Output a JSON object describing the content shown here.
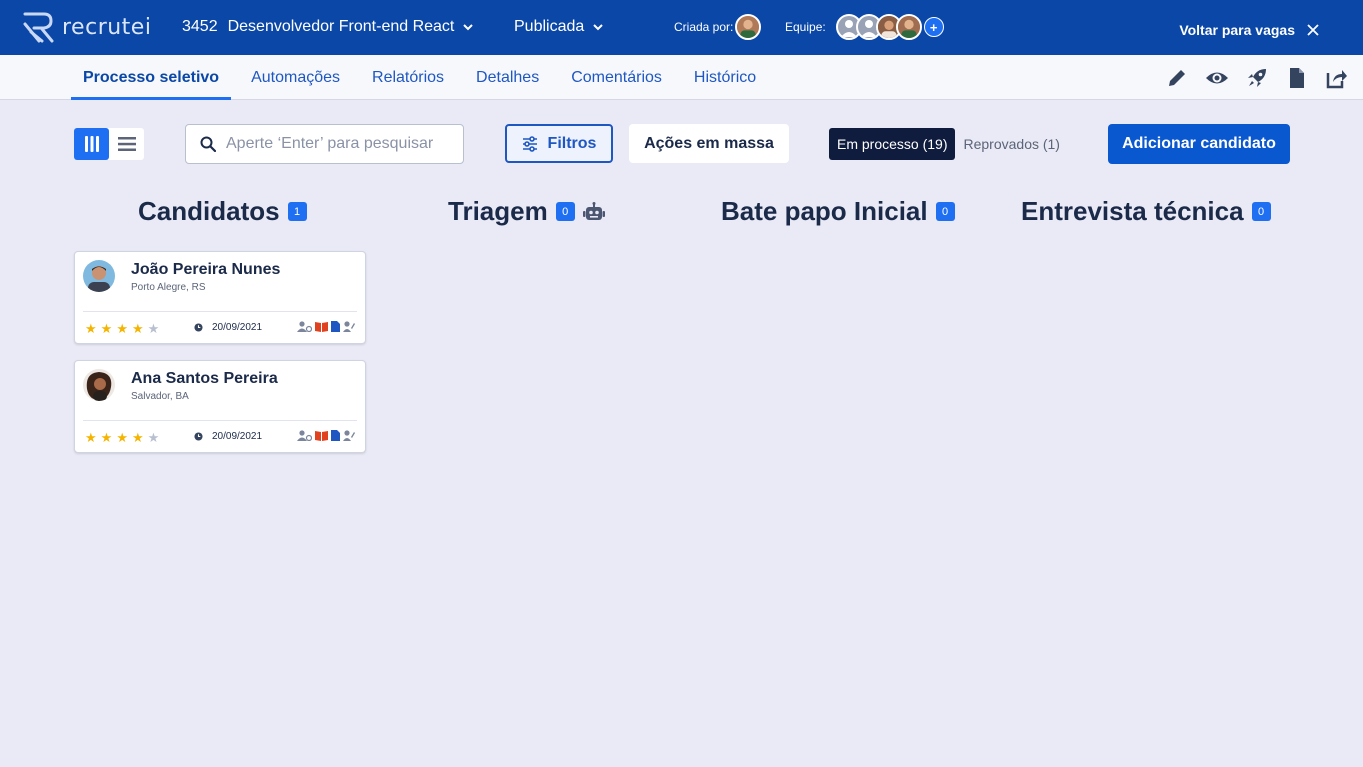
{
  "header": {
    "logo_text": "recrutei",
    "job_id": "3452",
    "job_title": "Desenvolvedor Front-end React",
    "status": "Publicada",
    "created_by_label": "Criada por:",
    "team_label": "Equipe:",
    "back_label": "Voltar para vagas"
  },
  "tabs": [
    {
      "label": "Processo seletivo",
      "active": true
    },
    {
      "label": "Automações"
    },
    {
      "label": "Relatórios"
    },
    {
      "label": "Detalhes"
    },
    {
      "label": "Comentários"
    },
    {
      "label": "Histórico"
    }
  ],
  "tool_icons": [
    "pencil-icon",
    "eye-icon",
    "rocket-icon",
    "document-icon",
    "share-icon"
  ],
  "toolbar": {
    "search_placeholder": "Aperte ‘Enter’ para pesquisar",
    "filter_label": "Filtros",
    "mass_actions_label": "Ações em massa",
    "segment_in_process": "Em processo (19)",
    "segment_rejected": "Reprovados (1)",
    "add_candidate_label": "Adicionar candidato"
  },
  "columns": [
    {
      "title": "Candidatos",
      "count": "1"
    },
    {
      "title": "Triagem",
      "count": "0"
    },
    {
      "title": "Bate papo Inicial",
      "count": "0"
    },
    {
      "title": "Entrevista técnica",
      "count": "0"
    }
  ],
  "candidates": [
    {
      "name": "João Pereira Nunes",
      "location": "Porto Alegre, RS",
      "rating": 4,
      "date": "20/09/2021"
    },
    {
      "name": "Ana Santos Pereira",
      "location": "Salvador, BA",
      "rating": 4,
      "date": "20/09/2021"
    }
  ],
  "colors": {
    "header_bg": "#0a47a6",
    "accent": "#1f6ff2",
    "page_bg": "#e9eaf5",
    "star": "#f4b400"
  }
}
